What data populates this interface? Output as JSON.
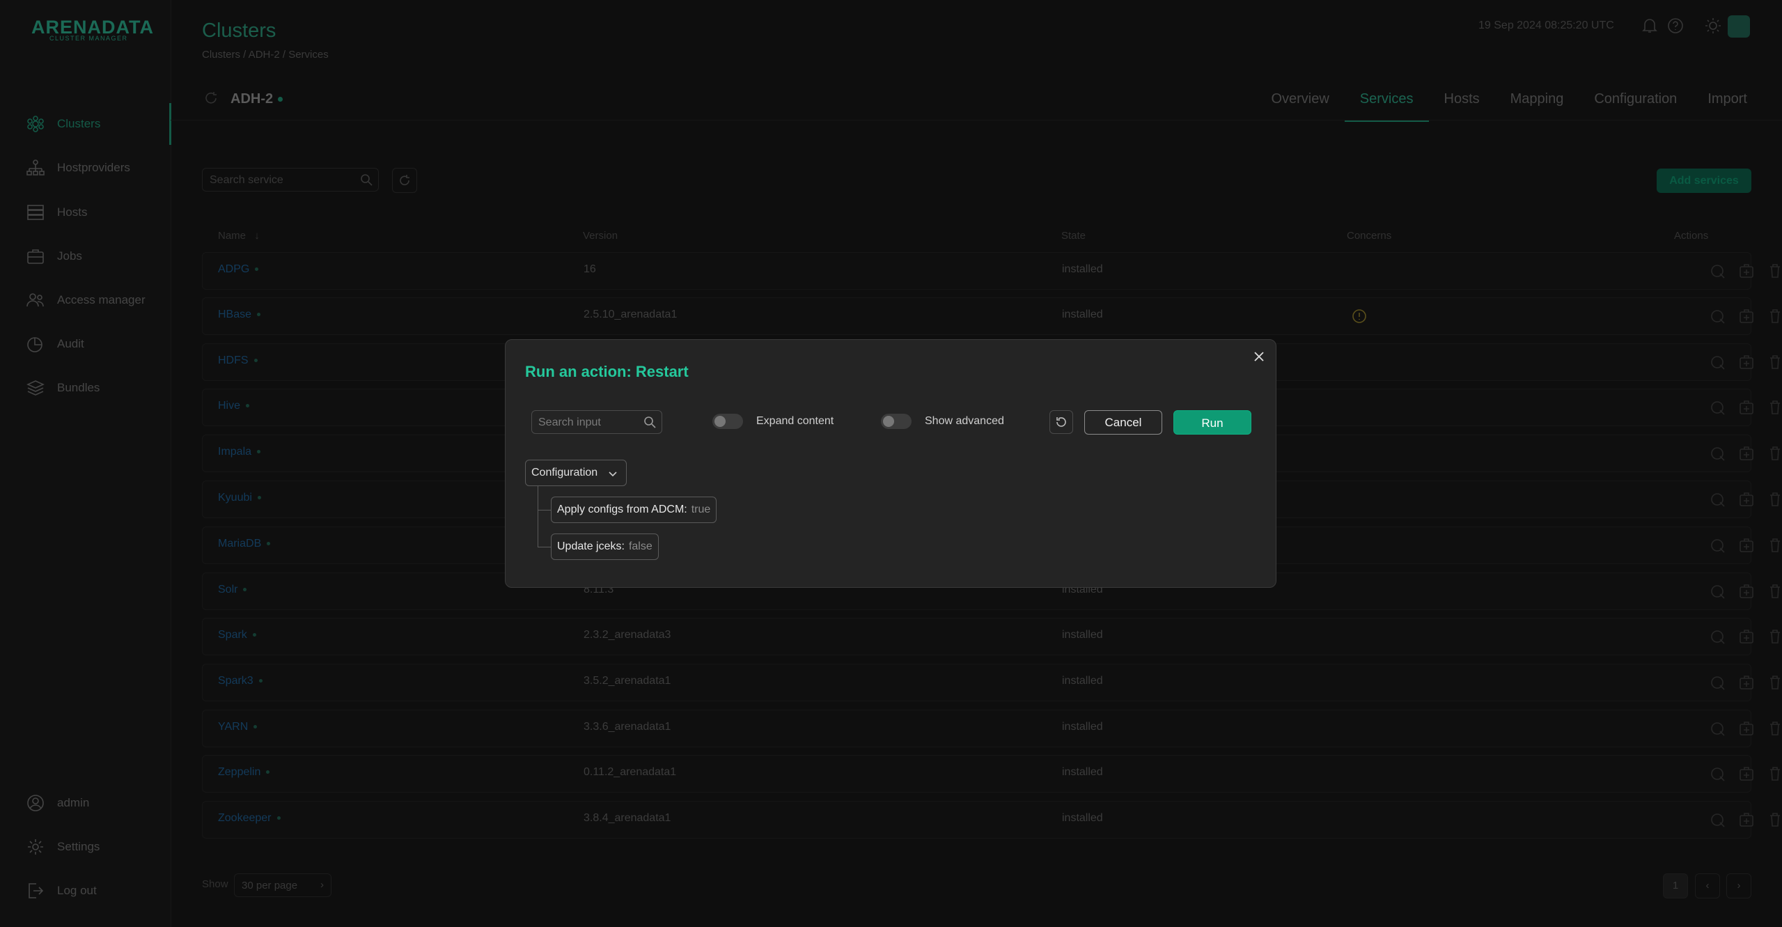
{
  "app": {
    "logo_main": "ARENADATA",
    "logo_sub": "CLUSTER MANAGER"
  },
  "sidebar": {
    "items": [
      {
        "label": "Clusters",
        "icon": "clusters-icon",
        "active": true
      },
      {
        "label": "Hostproviders",
        "icon": "hostproviders-icon"
      },
      {
        "label": "Hosts",
        "icon": "hosts-icon"
      },
      {
        "label": "Jobs",
        "icon": "jobs-icon"
      },
      {
        "label": "Access manager",
        "icon": "access-manager-icon"
      },
      {
        "label": "Audit",
        "icon": "audit-icon"
      },
      {
        "label": "Bundles",
        "icon": "bundles-icon"
      }
    ],
    "bottom": [
      {
        "label": "admin",
        "icon": "user-icon"
      },
      {
        "label": "Settings",
        "icon": "gear-icon"
      },
      {
        "label": "Log out",
        "icon": "logout-icon"
      }
    ]
  },
  "header": {
    "title": "Clusters",
    "breadcrumb": "Clusters / ADH-2 / Services",
    "datetime": "19 Sep 2024  08:25:20  UTC"
  },
  "cluster": {
    "name": "ADH-2",
    "tabs": [
      "Overview",
      "Services",
      "Hosts",
      "Mapping",
      "Configuration",
      "Import"
    ],
    "active_tab": "Services"
  },
  "toolbar": {
    "search_placeholder": "Search service",
    "add_label": "Add services"
  },
  "table": {
    "headers": {
      "name": "Name",
      "version": "Version",
      "state": "State",
      "concerns": "Concerns",
      "actions": "Actions"
    },
    "rows": [
      {
        "name": "ADPG",
        "version": "16",
        "state": "installed"
      },
      {
        "name": "HBase",
        "version": "2.5.10_arenadata1",
        "state": "installed",
        "concern": true
      },
      {
        "name": "HDFS",
        "version": "",
        "state": ""
      },
      {
        "name": "Hive",
        "version": "",
        "state": ""
      },
      {
        "name": "Impala",
        "version": "",
        "state": ""
      },
      {
        "name": "Kyuubi",
        "version": "",
        "state": ""
      },
      {
        "name": "MariaDB",
        "version": "",
        "state": ""
      },
      {
        "name": "Solr",
        "version": "8.11.3",
        "state": "installed"
      },
      {
        "name": "Spark",
        "version": "2.3.2_arenadata3",
        "state": "installed"
      },
      {
        "name": "Spark3",
        "version": "3.5.2_arenadata1",
        "state": "installed"
      },
      {
        "name": "YARN",
        "version": "3.3.6_arenadata1",
        "state": "installed"
      },
      {
        "name": "Zeppelin",
        "version": "0.11.2_arenadata1",
        "state": "installed"
      },
      {
        "name": "Zookeeper",
        "version": "3.8.4_arenadata1",
        "state": "installed"
      }
    ]
  },
  "pagination": {
    "show_label": "Show",
    "per_page": "30 per page",
    "page": "1"
  },
  "modal": {
    "title": "Run an action: Restart",
    "search_placeholder": "Search input",
    "expand_label": "Expand content",
    "advanced_label": "Show advanced",
    "cancel_label": "Cancel",
    "run_label": "Run",
    "config_label": "Configuration",
    "params": [
      {
        "label": "Apply configs from ADCM:",
        "value": "true"
      },
      {
        "label": "Update jceks:",
        "value": "false"
      }
    ]
  },
  "colors": {
    "accent": "#25c89c",
    "run_button": "#0e9b74"
  }
}
